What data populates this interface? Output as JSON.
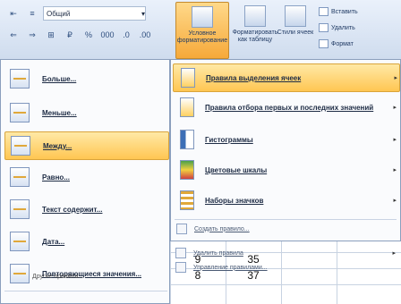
{
  "toolbar": {
    "number_format": "Общий",
    "row1_icons": [
      "indent-decrease-icon",
      "format-icon",
      "number-format-dropdown"
    ],
    "row2_icons": [
      "align-left-icon",
      "align-right-icon",
      "merge-icon",
      "currency-icon",
      "percent-icon",
      "thousands-icon",
      "decimal-increase-icon",
      "decimal-decrease-icon"
    ]
  },
  "ribbon": {
    "conditional_formatting": "Условное форматирование",
    "format_as_table": "Форматировать как таблицу",
    "cell_styles": "Стили ячеек",
    "insert": "Вставить",
    "delete": "Удалить",
    "format": "Формат"
  },
  "left_menu": {
    "items": [
      "Больше...",
      "Меньше...",
      "Между...",
      "Равно...",
      "Текст содержит...",
      "Дата...",
      "Повторяющиеся значения..."
    ],
    "highlighted_index": 2,
    "more_rules": "Другие правила..."
  },
  "right_menu": {
    "items": [
      "Правила выделения ячеек",
      "Правила отбора первых и последних значений",
      "Гистограммы",
      "Цветовые шкалы",
      "Наборы значков"
    ],
    "highlighted_index": 0,
    "secondary_items": [
      "Создать правило...",
      "Удалить правила",
      "Управление правилами..."
    ]
  },
  "sheet": {
    "rows": [
      [
        "9",
        "35"
      ],
      [
        "8",
        "37"
      ]
    ]
  }
}
